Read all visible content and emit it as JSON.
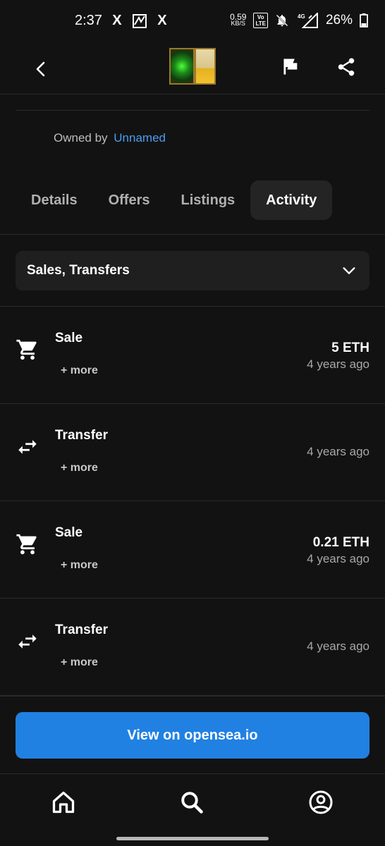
{
  "status_bar": {
    "time": "2:37",
    "x_label": "X",
    "net_speed_value": "0.59",
    "net_speed_unit": "KB/S",
    "volte_top": "Vo",
    "volte_bottom": "LTE",
    "network": "4G",
    "battery": "26%"
  },
  "app_bar": {
    "back_icon": "chevron-left-icon",
    "flag_icon": "flag-icon",
    "share_icon": "share-icon"
  },
  "owner": {
    "label": "Owned by",
    "name": "Unnamed",
    "name_color": "#4a9df0"
  },
  "tabs": [
    {
      "label": "Details",
      "active": false
    },
    {
      "label": "Offers",
      "active": false
    },
    {
      "label": "Listings",
      "active": false
    },
    {
      "label": "Activity",
      "active": true
    }
  ],
  "filter": {
    "value": "Sales, Transfers",
    "icon": "chevron-down-icon"
  },
  "activity": [
    {
      "type": "Sale",
      "icon": "cart-icon",
      "more": "+ more",
      "price": "5 ETH",
      "time": "4 years ago"
    },
    {
      "type": "Transfer",
      "icon": "transfer-arrows-icon",
      "more": "+ more",
      "price": "",
      "time": "4 years ago"
    },
    {
      "type": "Sale",
      "icon": "cart-icon",
      "more": "+ more",
      "price": "0.21 ETH",
      "time": "4 years ago"
    },
    {
      "type": "Transfer",
      "icon": "transfer-arrows-icon",
      "more": "+ more",
      "price": "",
      "time": "4 years ago"
    }
  ],
  "cta": {
    "label": "View on opensea.io",
    "color": "#2081e2"
  },
  "bottom_nav": [
    {
      "icon": "home-icon"
    },
    {
      "icon": "search-icon"
    },
    {
      "icon": "account-icon"
    }
  ]
}
